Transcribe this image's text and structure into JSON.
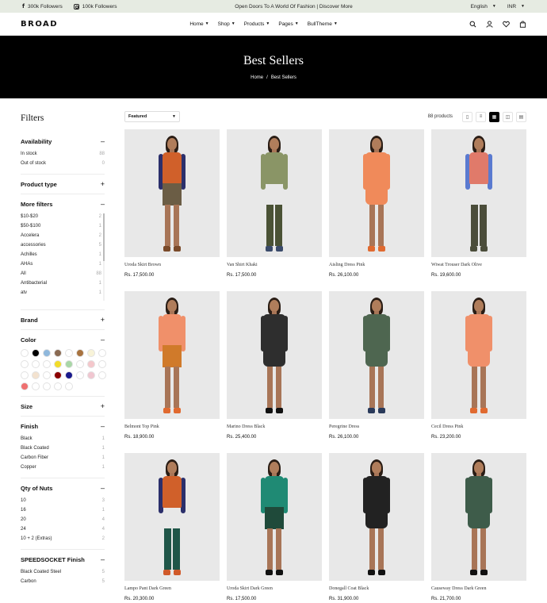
{
  "topbar": {
    "facebook": "300k Followers",
    "instagram": "100k Followers",
    "announcement": "Open Doors To A World Of Fashion | Discover More",
    "language": "English",
    "currency": "INR"
  },
  "header": {
    "logo": "BROAD",
    "nav": [
      "Home",
      "Shop",
      "Products",
      "Pages",
      "BullTheme"
    ]
  },
  "hero": {
    "title": "Best Sellers",
    "crumb_home": "Home",
    "crumb_sep": "/",
    "crumb_current": "Best Sellers"
  },
  "filters": {
    "title": "Filters",
    "availability": {
      "label": "Availability",
      "options": [
        {
          "label": "In stock",
          "count": "88"
        },
        {
          "label": "Out of stock",
          "count": "0"
        }
      ]
    },
    "product_type": {
      "label": "Product type"
    },
    "more_filters": {
      "label": "More filters",
      "options": [
        {
          "label": "$10-$20",
          "count": "2"
        },
        {
          "label": "$50-$100",
          "count": "1"
        },
        {
          "label": "Accelera",
          "count": "2"
        },
        {
          "label": "accessories",
          "count": "5"
        },
        {
          "label": "Achilles",
          "count": "1"
        },
        {
          "label": "AHAs",
          "count": "1"
        },
        {
          "label": "All",
          "count": "88"
        },
        {
          "label": "Antibacterial",
          "count": "1"
        },
        {
          "label": "atv",
          "count": "1"
        }
      ]
    },
    "brand": {
      "label": "Brand"
    },
    "color": {
      "label": "Color",
      "swatches": [
        "#ffffff",
        "#000000",
        "#8fb8dc",
        "#8a6a52",
        "#ffffff",
        "#a8733f",
        "#f8f3d8",
        "#ffffff",
        "#ffffff",
        "#ffffff",
        "#ffffff",
        "#f2dc2a",
        "#a9d6a7",
        "#ffffff",
        "#f4c7cb",
        "#ffffff",
        "#ffffff",
        "#f3e2cf",
        "#ffffff",
        "#8b0000",
        "#1a1a8c",
        "#ffffff",
        "#f0c6d0",
        "#ffffff",
        "#ef7070",
        "#ffffff",
        "#ffffff",
        "#ffffff",
        "#ffffff"
      ]
    },
    "size": {
      "label": "Size"
    },
    "finish": {
      "label": "Finish",
      "options": [
        {
          "label": "Black",
          "count": "1"
        },
        {
          "label": "Black Coated",
          "count": "1"
        },
        {
          "label": "Carbon Fiber",
          "count": "1"
        },
        {
          "label": "Copper",
          "count": "1"
        }
      ]
    },
    "qty_nuts": {
      "label": "Qty of Nuts",
      "options": [
        {
          "label": "10",
          "count": "3"
        },
        {
          "label": "16",
          "count": "1"
        },
        {
          "label": "20",
          "count": "4"
        },
        {
          "label": "24",
          "count": "4"
        },
        {
          "label": "10 + 2 (Extras)",
          "count": "2"
        }
      ]
    },
    "speedsocket": {
      "label": "SPEEDSOCKET Finish",
      "options": [
        {
          "label": "Black Coated Steel",
          "count": "5"
        },
        {
          "label": "Carbon",
          "count": "5"
        }
      ]
    }
  },
  "toolbar": {
    "sort": "Featured",
    "count": "88 products"
  },
  "products": [
    {
      "name": "Uroda Skirt Brown",
      "price": "Rs. 17,500.00"
    },
    {
      "name": "Van Shirt Khaki",
      "price": "Rs. 17,500.00"
    },
    {
      "name": "Aisling Dress Pink",
      "price": "Rs. 26,100.00"
    },
    {
      "name": "Wiwat Trouser Dark Olive",
      "price": "Rs. 19,600.00"
    },
    {
      "name": "Belmont Top Pink",
      "price": "Rs. 18,900.00"
    },
    {
      "name": "Marino Dress Black",
      "price": "Rs. 25,400.00"
    },
    {
      "name": "Peregrine Dress",
      "price": "Rs. 26,100.00"
    },
    {
      "name": "Cecil Dress Pink",
      "price": "Rs. 23,200.00"
    },
    {
      "name": "Lampo Pant Dark Green",
      "price": "Rs. 20,300.00"
    },
    {
      "name": "Uroda Skirt Dark Green",
      "price": "Rs. 17,500.00"
    },
    {
      "name": "Donegall Coat Black",
      "price": "Rs. 31,900.00"
    },
    {
      "name": "Causeway Dress Dark Green",
      "price": "Rs. 21,700.00"
    }
  ]
}
